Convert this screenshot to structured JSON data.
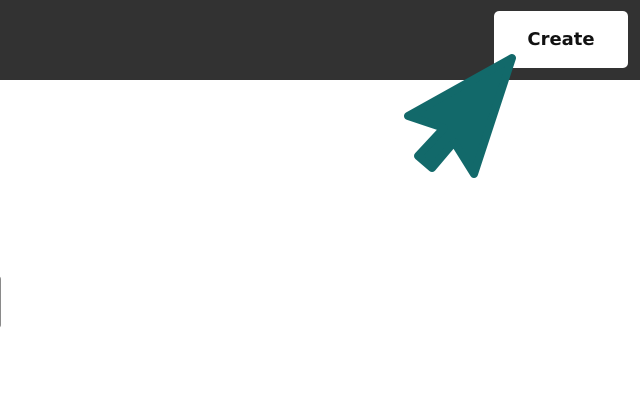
{
  "header": {
    "create_button_label": "Create"
  },
  "pointer": {
    "icon": "cursor-arrow-icon",
    "color": "#12696a"
  },
  "colors": {
    "topbar_background": "#323232",
    "button_background": "#ffffff",
    "page_background": "#ffffff"
  }
}
